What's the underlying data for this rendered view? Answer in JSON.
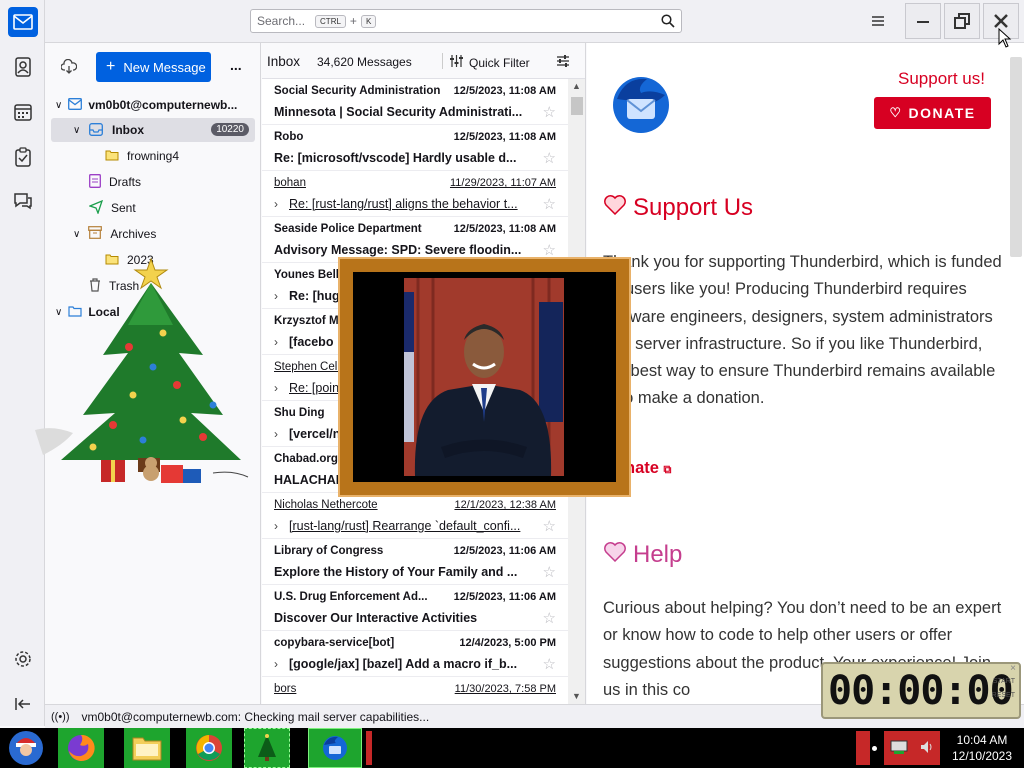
{
  "search": {
    "placeholder": "Search...",
    "key1": "CTRL",
    "plus": "+",
    "key2": "K"
  },
  "folders": {
    "new_message_label": "New Message",
    "more_label": "...",
    "account": "vm0b0t@computernewb...",
    "inbox": "Inbox",
    "inbox_count": "10220",
    "frowning": "frowning4",
    "drafts": "Drafts",
    "sent": "Sent",
    "archives": "Archives",
    "year": "2023",
    "trash": "Trash",
    "local": "Local"
  },
  "thread": {
    "folder_name": "Inbox",
    "message_count": "34,620 Messages",
    "quick_filter": "Quick Filter",
    "rows": [
      {
        "sender": "Social Security Administration",
        "date": "12/5/2023, 11:08 AM",
        "subject": "Minnesota | Social Security Administrati..."
      },
      {
        "sender": "Robo",
        "date": "12/5/2023, 11:08 AM",
        "subject": "Re: [microsoft/vscode] Hardly usable d..."
      },
      {
        "sender": "bohan",
        "date": "11/29/2023, 11:07 AM",
        "subject": "Re: [rust-lang/rust] aligns the behavior t..."
      },
      {
        "sender": "Seaside Police Department",
        "date": "12/5/2023, 11:08 AM",
        "subject": "Advisory Message: SPD: Severe floodin..."
      },
      {
        "sender": "Younes Belk",
        "date": "",
        "subject": "Re: [hug"
      },
      {
        "sender": "Krzysztof M",
        "date": "",
        "subject": "[facebo"
      },
      {
        "sender": "Stephen Celis",
        "date": "",
        "subject": "Re: [poin"
      },
      {
        "sender": "Shu Ding",
        "date": "",
        "subject": "[vercel/n"
      },
      {
        "sender": "Chabad.org",
        "date": "",
        "subject": "HALACHAH"
      },
      {
        "sender": "Nicholas Nethercote",
        "date": "12/1/2023, 12:38 AM",
        "subject": "[rust-lang/rust] Rearrange `default_confi..."
      },
      {
        "sender": "Library of Congress",
        "date": "12/5/2023, 11:06 AM",
        "subject": "Explore the History of Your Family and ..."
      },
      {
        "sender": "U.S. Drug Enforcement Ad...",
        "date": "12/5/2023, 11:06 AM",
        "subject": "Discover Our Interactive Activities"
      },
      {
        "sender": "copybara-service[bot]",
        "date": "12/4/2023, 5:00 PM",
        "subject": "[google/jax] [bazel] Add a macro if_b..."
      },
      {
        "sender": "bors",
        "date": "11/30/2023, 7:58 PM",
        "subject": ""
      }
    ]
  },
  "message": {
    "support_link": "Support us!",
    "donate_button": "DONATE",
    "support_heading": "Support Us",
    "support_text": "Thank you for supporting Thunderbird, which is funded by users like you! Producing Thunderbird requires software engineers, designers, system administrators and server infrastructure. So if you like Thunderbird, the best way to ensure Thunderbird remains available is to make a donation.",
    "donate_link": "Donate",
    "help_heading": "Help",
    "help_text": "Curious about helping? You don’t need to be an expert or know how to code to help other users or offer suggestions about the product. Your experience! Join us in this co"
  },
  "status": {
    "text": "vm0b0t@computernewb.com: Checking mail server capabilities..."
  },
  "taskbar": {
    "time": "10:04 AM",
    "date": "12/10/2023"
  },
  "timer": {
    "digits": "00:00:00",
    "label_start": "START",
    "label_reset": "RESET"
  },
  "colors": {
    "accent": "#0061e0",
    "donate": "#d70022",
    "support_red": "#d70022",
    "help_pink": "#c53e8e"
  }
}
